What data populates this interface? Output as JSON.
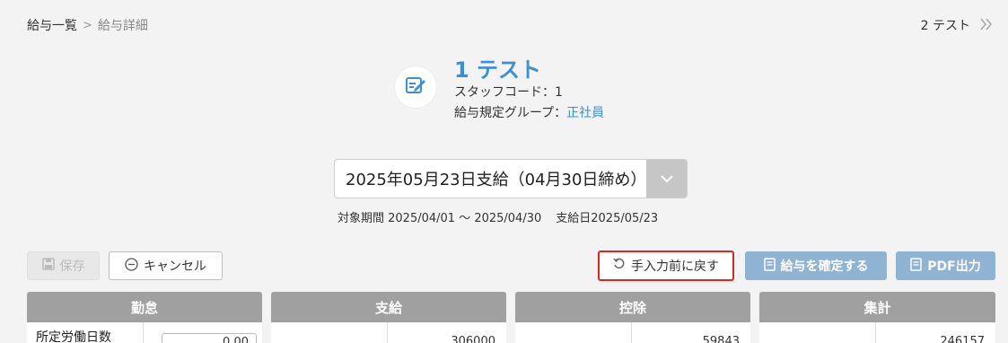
{
  "breadcrumb": {
    "parent": "給与一覧",
    "separator": ">",
    "current": "給与詳細"
  },
  "nav": {
    "next_label": "2 テスト",
    "next_icon": "double-chevron-right-icon"
  },
  "profile": {
    "name": "1 テスト",
    "staff_code": "スタッフコード：1",
    "group_label": "給与規定グループ：",
    "group_value": "正社員"
  },
  "period": {
    "selected": "2025年05月23日支給（04月30日締め）",
    "target_period": "対象期間 2025/04/01 〜 2025/04/30",
    "pay_date": "支給日2025/05/23"
  },
  "toolbar": {
    "save_label": "保存",
    "cancel_label": "キャンセル",
    "revert_label": "手入力前に戻す",
    "confirm_label": "給与を確定する",
    "pdf_label": "PDF出力"
  },
  "columns": {
    "attendance": "勤怠",
    "payment": "支給",
    "deduction": "控除",
    "summary": "集計"
  },
  "rows": {
    "attendance_label": "所定労働日数",
    "attendance_value": "0.00",
    "payment_value": "306000",
    "deduction_value": "59843",
    "summary_value": "246157"
  },
  "colors": {
    "accent": "#3d8fd4",
    "primary_button": "#8eb3d3",
    "header_gray": "#a0a0a0",
    "highlight_border": "#e0261b"
  }
}
